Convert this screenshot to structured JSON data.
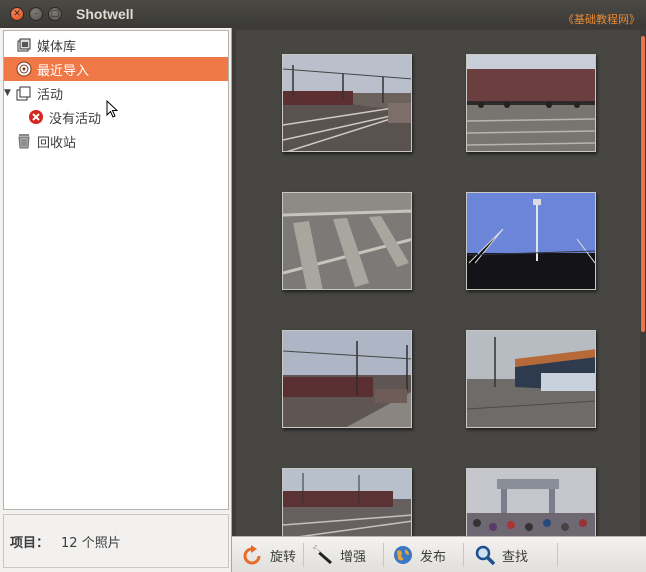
{
  "window": {
    "title": "Shotwell",
    "watermark": "《基础教程网》"
  },
  "sidebar": {
    "items": [
      {
        "label": "媒体库",
        "icon": "library-icon"
      },
      {
        "label": "最近导入",
        "icon": "import-icon",
        "selected": true
      },
      {
        "label": "活动",
        "icon": "events-icon",
        "expanded": true
      },
      {
        "label": "没有活动",
        "icon": "no-event-icon"
      },
      {
        "label": "回收站",
        "icon": "trash-icon"
      }
    ]
  },
  "status": {
    "label": "项目：",
    "value": "12 个照片"
  },
  "toolbar": {
    "rotate_label": "旋转",
    "enhance_label": "增强",
    "publish_label": "发布",
    "find_label": "查找"
  },
  "colors": {
    "selection": "#f07746",
    "viewer_bg": "#474643",
    "scroll_thumb": "#e8764a"
  },
  "photos": [
    {
      "name": "railway-platform-1"
    },
    {
      "name": "freight-train"
    },
    {
      "name": "railway-sleepers"
    },
    {
      "name": "lighting-tower"
    },
    {
      "name": "railway-platform-2"
    },
    {
      "name": "station-building"
    },
    {
      "name": "railway-platform-3"
    },
    {
      "name": "station-crowd"
    }
  ]
}
